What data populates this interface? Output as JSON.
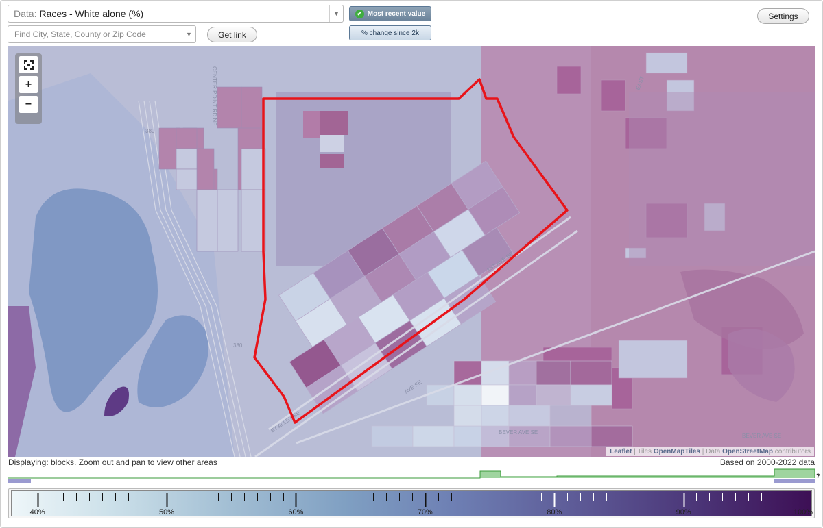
{
  "header": {
    "data_prefix": "Data:",
    "data_value": "Races - White alone (%)",
    "search_placeholder": "Find City, State, County or Zip Code",
    "get_link": "Get link",
    "mode_recent": "Most recent value",
    "mode_change": "% change since 2k",
    "settings": "Settings"
  },
  "map": {
    "zoom_in": "+",
    "zoom_out": "−",
    "labels": {
      "road_380_a": "380",
      "road_380_b": "380",
      "center_point": "CENTER POINT RD NE",
      "st_alley_se": "ST ALLEY SE",
      "ave_se": "AVE SE",
      "st_se": "1ST AVE SE",
      "bever_ave": "BEVER AVE SE",
      "bever_ave_2": "BEVER AVE SE",
      "east": "EAST"
    },
    "attribution": {
      "leaflet": "Leaflet",
      "sep1": " | Tiles ",
      "tiles": "OpenMapTiles",
      "sep2": " | Data ",
      "osm": "OpenStreetMap",
      "tail": " contributors"
    }
  },
  "status": {
    "displaying": "Displaying: blocks. Zoom out and pan to view other areas",
    "based_on": "Based on 2000-2022 data",
    "question": "?"
  },
  "legend": {
    "labels": [
      "40%",
      "50%",
      "60%",
      "70%",
      "80%",
      "90%",
      "100%"
    ],
    "min": 38,
    "max": 100,
    "colors": [
      "#eef6f9",
      "#a3bfd4",
      "#6e80b4",
      "#3d0f55"
    ]
  },
  "colors": {
    "selection_outline": "#e8141a",
    "histogram_line": "#3a9a3a",
    "histogram_fill": "#9fd49f",
    "histogram_band": "#9a9ad0"
  }
}
